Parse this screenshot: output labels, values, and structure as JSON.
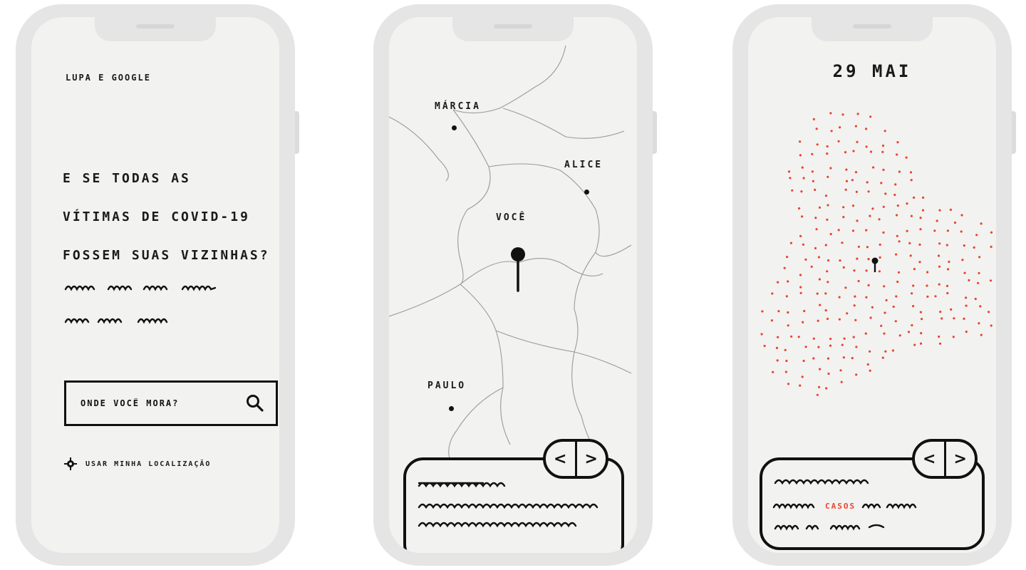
{
  "phone1": {
    "brand": "LUPA e GOOGLE",
    "headline": [
      "E SE TODAS AS",
      "VÍTIMAS DE COVID-19",
      "FOSSEM SUAS VIZINHAS?"
    ],
    "search": {
      "placeholder": "ONDE VOCÊ MORA?",
      "icon": "search-icon"
    },
    "location_link": {
      "label": "USAR MINHA LOCALIZAÇÃO",
      "icon": "crosshair-icon"
    }
  },
  "phone2": {
    "labels": {
      "marcia": "MÁRCIA",
      "alice": "ALICE",
      "voce": "VOCÊ",
      "paulo": "PAULO"
    },
    "nav": {
      "prev": "<",
      "next": ">"
    }
  },
  "phone3": {
    "date": "29 MAI",
    "highlight": "CASOS",
    "nav": {
      "prev": "<",
      "next": ">"
    }
  },
  "colors": {
    "accent": "#e8452c",
    "ink": "#111111",
    "screen": "#f2f2f1",
    "bezel": "#e5e5e5"
  }
}
